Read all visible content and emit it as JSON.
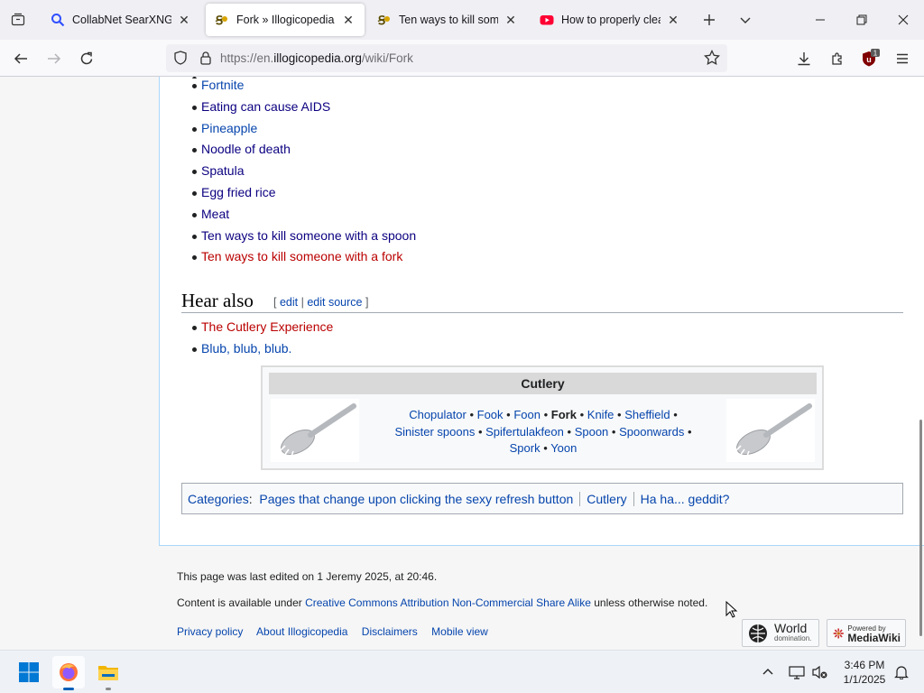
{
  "browser": {
    "tabs": [
      {
        "title": "CollabNet SearXNG",
        "icon": "search-favicon",
        "active": false
      },
      {
        "title": "Fork » Illogicopedia - T",
        "icon": "illogicopedia-favicon",
        "active": true
      },
      {
        "title": "Ten ways to kill someo",
        "icon": "illogicopedia-favicon",
        "active": false
      },
      {
        "title": "How to properly clean",
        "icon": "youtube-favicon",
        "active": false
      }
    ],
    "url_prefix": "https://en.",
    "url_domain": "illogicopedia.org",
    "url_path": "/wiki/Fork",
    "extension_badge": "1"
  },
  "article": {
    "list_items": [
      {
        "label": "Fortnite",
        "kind": "link"
      },
      {
        "label": "Eating can cause AIDS",
        "kind": "visited"
      },
      {
        "label": "Pineapple",
        "kind": "link"
      },
      {
        "label": "Noodle of death",
        "kind": "visited"
      },
      {
        "label": "Spatula",
        "kind": "visited"
      },
      {
        "label": "Egg fried rice",
        "kind": "visited"
      },
      {
        "label": "Meat",
        "kind": "visited"
      },
      {
        "label": "Ten ways to kill someone with a spoon",
        "kind": "visited"
      },
      {
        "label": "Ten ways to kill someone with a fork",
        "kind": "new"
      }
    ],
    "hear_also": {
      "heading": "Hear also",
      "edit_open": "[",
      "edit": "edit",
      "edit_sep": "|",
      "edit_source": "edit source",
      "edit_close": "]",
      "items": [
        {
          "label": "The Cutlery Experience",
          "kind": "new"
        },
        {
          "label": "Blub, blub, blub.",
          "kind": "link"
        }
      ]
    },
    "navbox": {
      "title": "Cutlery",
      "links_row1": [
        "Chopulator",
        "Fook",
        "Foon",
        "Fork",
        "Knife",
        "Sheffield"
      ],
      "links_row2": [
        "Sinister spoons",
        "Spifertulakfeon",
        "Spoon",
        "Spoonwards"
      ],
      "links_row3": [
        "Spork",
        "Yoon"
      ],
      "current": "Fork",
      "separator": "•"
    },
    "categories": {
      "label": "Categories",
      "items": [
        "Pages that change upon clicking the sexy refresh button",
        "Cutlery",
        "Ha ha... geddit?"
      ]
    }
  },
  "footer": {
    "last_edited": "This page was last edited on 1 Jeremy 2025, at 20:46.",
    "license_prefix": "Content is available under ",
    "license_link": "Creative Commons Attribution Non-Commercial Share Alike",
    "license_suffix": " unless otherwise noted.",
    "links": [
      "Privacy policy",
      "About Illogicopedia",
      "Disclaimers",
      "Mobile view"
    ],
    "badge_world_line1": "World",
    "badge_world_line2": "domination.",
    "badge_mw_line1": "Powered by",
    "badge_mw_line2": "MediaWiki"
  },
  "taskbar": {
    "time": "3:46 PM",
    "date": "1/1/2025"
  },
  "colors": {
    "link": "#0645ad",
    "visited": "#0b0080",
    "new_link": "#ba0000",
    "accent": "#005fb8"
  }
}
